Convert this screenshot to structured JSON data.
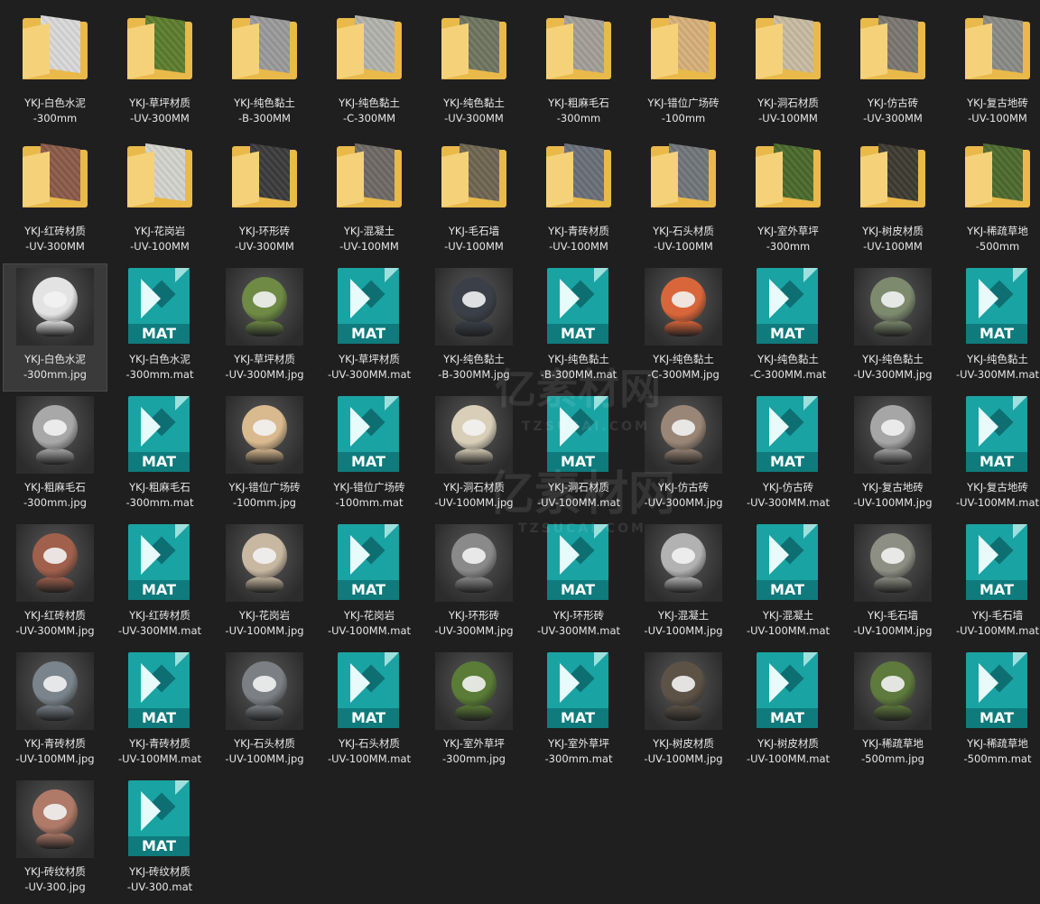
{
  "folders": [
    {
      "label": "YKJ-白色水泥\n-300mm",
      "swatch": "#d9d9d9"
    },
    {
      "label": "YKJ-草坪材质\n-UV-300MM",
      "swatch": "#5d7d2e"
    },
    {
      "label": "YKJ-纯色黏土\n-B-300MM",
      "swatch": "#9a9a9a"
    },
    {
      "label": "YKJ-纯色黏土\n-C-300MM",
      "swatch": "#b3b3ad"
    },
    {
      "label": "YKJ-纯色黏土\n-UV-300MM",
      "swatch": "#6f7560"
    },
    {
      "label": "YKJ-粗麻毛石\n-300mm",
      "swatch": "#a39e98"
    },
    {
      "label": "YKJ-错位广场砖\n-100mm",
      "swatch": "#d7b07a"
    },
    {
      "label": "YKJ-洞石材质\n-UV-100MM",
      "swatch": "#c9bba2"
    },
    {
      "label": "YKJ-仿古砖\n-UV-300MM",
      "swatch": "#7b7670"
    },
    {
      "label": "YKJ-复古地砖\n-UV-100MM",
      "swatch": "#8a8a86"
    },
    {
      "label": "YKJ-红砖材质\n-UV-300MM",
      "swatch": "#8a5a48"
    },
    {
      "label": "YKJ-花岗岩\n-UV-100MM",
      "swatch": "#d3d3cd"
    },
    {
      "label": "YKJ-环形砖\n-UV-300MM",
      "swatch": "#3c3c3c"
    },
    {
      "label": "YKJ-混凝土\n-UV-100MM",
      "swatch": "#6e6965"
    },
    {
      "label": "YKJ-毛石墙\n-UV-100MM",
      "swatch": "#6f6552"
    },
    {
      "label": "YKJ-青砖材质\n-UV-100MM",
      "swatch": "#6a7078"
    },
    {
      "label": "YKJ-石头材质\n-UV-100MM",
      "swatch": "#71767a"
    },
    {
      "label": "YKJ-室外草坪\n-300mm",
      "swatch": "#4a6a2c"
    },
    {
      "label": "YKJ-树皮材质\n-UV-100MM",
      "swatch": "#3e3a32"
    },
    {
      "label": "YKJ-稀疏草地\n-500mm",
      "swatch": "#4e6a2e"
    }
  ],
  "files": [
    {
      "type": "render",
      "label": "YKJ-白色水泥\n-300mm.jpg",
      "color": "#e3e3e3",
      "selected": true
    },
    {
      "type": "mat",
      "label": "YKJ-白色水泥\n-300mm.mat"
    },
    {
      "type": "render",
      "label": "YKJ-草坪材质\n-UV-300MM.jpg",
      "color": "#6e8a45"
    },
    {
      "type": "mat",
      "label": "YKJ-草坪材质\n-UV-300MM.mat"
    },
    {
      "type": "render",
      "label": "YKJ-纯色黏土\n-B-300MM.jpg",
      "color": "#3b4048"
    },
    {
      "type": "mat",
      "label": "YKJ-纯色黏土\n-B-300MM.mat"
    },
    {
      "type": "render",
      "label": "YKJ-纯色黏土\n-C-300MM.jpg",
      "color": "#d9663a"
    },
    {
      "type": "mat",
      "label": "YKJ-纯色黏土\n-C-300MM.mat"
    },
    {
      "type": "render",
      "label": "YKJ-纯色黏土\n-UV-300MM.jpg",
      "color": "#7d8a6e"
    },
    {
      "type": "mat",
      "label": "YKJ-纯色黏土\n-UV-300MM.mat"
    },
    {
      "type": "render",
      "label": "YKJ-粗麻毛石\n-300mm.jpg",
      "color": "#a8a8a8"
    },
    {
      "type": "mat",
      "label": "YKJ-粗麻毛石\n-300mm.mat"
    },
    {
      "type": "render",
      "label": "YKJ-错位广场砖\n-100mm.jpg",
      "color": "#d9b98e"
    },
    {
      "type": "mat",
      "label": "YKJ-错位广场砖\n-100mm.mat"
    },
    {
      "type": "render",
      "label": "YKJ-洞石材质\n-UV-100MM.jpg",
      "color": "#d9cfb8"
    },
    {
      "type": "mat",
      "label": "YKJ-洞石材质\n-UV-100MM.mat"
    },
    {
      "type": "render",
      "label": "YKJ-仿古砖\n-UV-300MM.jpg",
      "color": "#9a8676"
    },
    {
      "type": "mat",
      "label": "YKJ-仿古砖\n-UV-300MM.mat"
    },
    {
      "type": "render",
      "label": "YKJ-复古地砖\n-UV-100MM.jpg",
      "color": "#a6a6a6"
    },
    {
      "type": "mat",
      "label": "YKJ-复古地砖\n-UV-100MM.mat"
    },
    {
      "type": "render",
      "label": "YKJ-红砖材质\n-UV-300MM.jpg",
      "color": "#a0604c"
    },
    {
      "type": "mat",
      "label": "YKJ-红砖材质\n-UV-300MM.mat"
    },
    {
      "type": "render",
      "label": "YKJ-花岗岩\n-UV-100MM.jpg",
      "color": "#c8b8a2"
    },
    {
      "type": "mat",
      "label": "YKJ-花岗岩\n-UV-100MM.mat"
    },
    {
      "type": "render",
      "label": "YKJ-环形砖\n-UV-300MM.jpg",
      "color": "#8a8a8a"
    },
    {
      "type": "mat",
      "label": "YKJ-环形砖\n-UV-300MM.mat"
    },
    {
      "type": "render",
      "label": "YKJ-混凝土\n-UV-100MM.jpg",
      "color": "#b2b2b2"
    },
    {
      "type": "mat",
      "label": "YKJ-混凝土\n-UV-100MM.mat"
    },
    {
      "type": "render",
      "label": "YKJ-毛石墙\n-UV-100MM.jpg",
      "color": "#8e8f84"
    },
    {
      "type": "mat",
      "label": "YKJ-毛石墙\n-UV-100MM.mat"
    },
    {
      "type": "render",
      "label": "YKJ-青砖材质\n-UV-100MM.jpg",
      "color": "#7a848c"
    },
    {
      "type": "mat",
      "label": "YKJ-青砖材质\n-UV-100MM.mat"
    },
    {
      "type": "render",
      "label": "YKJ-石头材质\n-UV-100MM.jpg",
      "color": "#7c8085"
    },
    {
      "type": "mat",
      "label": "YKJ-石头材质\n-UV-100MM.mat"
    },
    {
      "type": "render",
      "label": "YKJ-室外草坪\n-300mm.jpg",
      "color": "#5a7c36"
    },
    {
      "type": "mat",
      "label": "YKJ-室外草坪\n-300mm.mat"
    },
    {
      "type": "render",
      "label": "YKJ-树皮材质\n-UV-100MM.jpg",
      "color": "#5c5246"
    },
    {
      "type": "mat",
      "label": "YKJ-树皮材质\n-UV-100MM.mat"
    },
    {
      "type": "render",
      "label": "YKJ-稀疏草地\n-500mm.jpg",
      "color": "#5e7a3c"
    },
    {
      "type": "mat",
      "label": "YKJ-稀疏草地\n-500mm.mat"
    },
    {
      "type": "render",
      "label": "YKJ-砖纹材质\n-UV-300.jpg",
      "color": "#b07a68"
    },
    {
      "type": "mat",
      "label": "YKJ-砖纹材质\n-UV-300.mat"
    }
  ],
  "mat_badge": "MAT",
  "watermark": {
    "text": "亿素材网",
    "sub": "TZSUCAI.COM"
  }
}
